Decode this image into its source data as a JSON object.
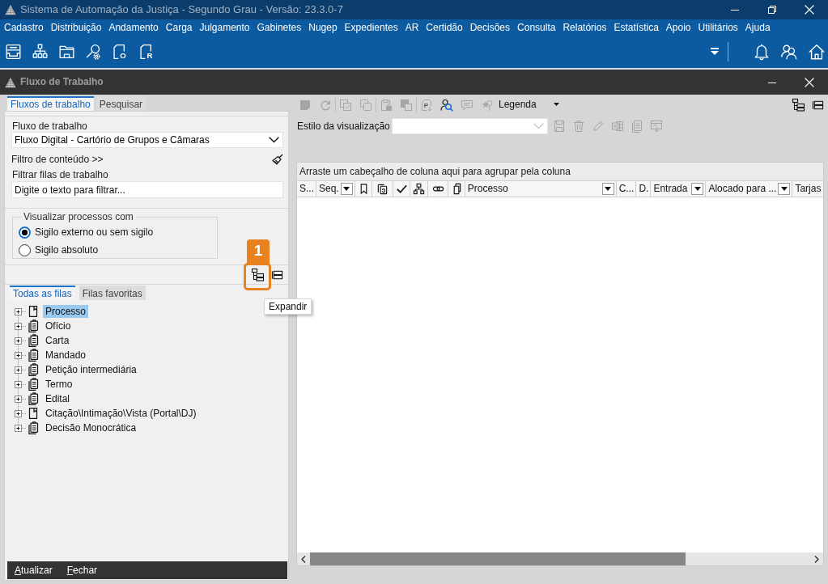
{
  "window": {
    "title": "Sistema de Automação da Justiça - Segundo Grau - Versão: 23.3.0-7"
  },
  "menu": [
    "Cadastro",
    "Distribuição",
    "Andamento",
    "Carga",
    "Julgamento",
    "Gabinetes",
    "Nugep",
    "Expedientes",
    "AR",
    "Certidão",
    "Decisões",
    "Consulta",
    "Relatórios",
    "Estatística",
    "Apoio",
    "Utilitários",
    "Ajuda"
  ],
  "toolbar": {
    "document_letters": [
      "O",
      "R"
    ]
  },
  "child_window": {
    "title": "Fluxo de Trabalho"
  },
  "left_panel": {
    "tabs": [
      {
        "label": "Fluxos de trabalho",
        "selected": true
      },
      {
        "label": "Pesquisar",
        "selected": false
      }
    ],
    "workflow": {
      "label": "Fluxo de trabalho",
      "value": "Fluxo Digital - Cartório de Grupos e Câmaras"
    },
    "content_filter": "Filtro de conteúdo >>",
    "queue_filter": {
      "label": "Filtrar filas de trabalho",
      "placeholder": "Digite o texto para filtrar..."
    },
    "visibility": {
      "legend": "Visualizar processos com",
      "options": [
        {
          "label": "Sigilo externo ou sem sigilo",
          "selected": true
        },
        {
          "label": "Sigilo absoluto",
          "selected": false
        }
      ]
    },
    "callout": {
      "number": "1"
    },
    "tooltip": "Expandir",
    "queue_tabs": [
      {
        "label": "Todas as filas",
        "selected": true
      },
      {
        "label": "Filas favoritas",
        "selected": false
      }
    ],
    "tree": [
      {
        "label": "Processo",
        "kind": "single",
        "expanded": false,
        "selected": true
      },
      {
        "label": "Ofício",
        "kind": "stack",
        "expanded": false,
        "selected": false
      },
      {
        "label": "Carta",
        "kind": "stack",
        "expanded": false,
        "selected": false
      },
      {
        "label": "Mandado",
        "kind": "stack",
        "expanded": false,
        "selected": false
      },
      {
        "label": "Petição intermediária",
        "kind": "stack",
        "expanded": false,
        "selected": false
      },
      {
        "label": "Termo",
        "kind": "stack",
        "expanded": false,
        "selected": false
      },
      {
        "label": "Edital",
        "kind": "stack",
        "expanded": false,
        "selected": false
      },
      {
        "label": "Citação\\Intimação\\Vista (Portal\\DJ)",
        "kind": "single",
        "expanded": false,
        "selected": false
      },
      {
        "label": "Decisão Monocrática",
        "kind": "stack",
        "expanded": false,
        "selected": false
      }
    ],
    "buttons": [
      "Atualizar",
      "Fechar"
    ]
  },
  "right_panel": {
    "toolbar": [
      [
        {
          "disabled": true
        },
        {
          "disabled": true
        }
      ],
      [
        {
          "disabled": true
        },
        {
          "disabled": true
        }
      ],
      [
        {
          "disabled": true
        },
        {
          "disabled": true
        }
      ],
      [
        {
          "disabled": true,
          "letter": "P"
        },
        {
          "disabled": false
        },
        {
          "disabled": true
        },
        {
          "disabled": true
        }
      ]
    ],
    "legend_menu": "Legenda",
    "view_style": {
      "label": "Estilo da visualização",
      "tools": [
        {
          "disabled": true
        },
        {
          "disabled": true
        },
        {
          "disabled": true
        },
        {
          "disabled": true
        },
        {
          "disabled": true
        },
        {
          "disabled": true
        }
      ]
    },
    "group_hint": "Arraste um cabeçalho de coluna aqui para agrupar pela coluna",
    "columns": [
      {
        "kind": "text",
        "label": "S...",
        "filter": false
      },
      {
        "kind": "text",
        "label": "Seq.",
        "filter": true
      },
      {
        "kind": "icon"
      },
      {
        "kind": "icon"
      },
      {
        "kind": "icon"
      },
      {
        "kind": "icon"
      },
      {
        "kind": "icon"
      },
      {
        "kind": "icon"
      },
      {
        "kind": "text",
        "label": "Processo",
        "filter": true
      },
      {
        "kind": "text",
        "label": "C...",
        "filter": false
      },
      {
        "kind": "text",
        "label": "D.",
        "filter": false
      },
      {
        "kind": "text",
        "label": "Entrada",
        "filter": true
      },
      {
        "kind": "text",
        "label": "Alocado para ...",
        "filter": true
      },
      {
        "kind": "text",
        "label": "Tarjas",
        "filter": false
      }
    ]
  }
}
